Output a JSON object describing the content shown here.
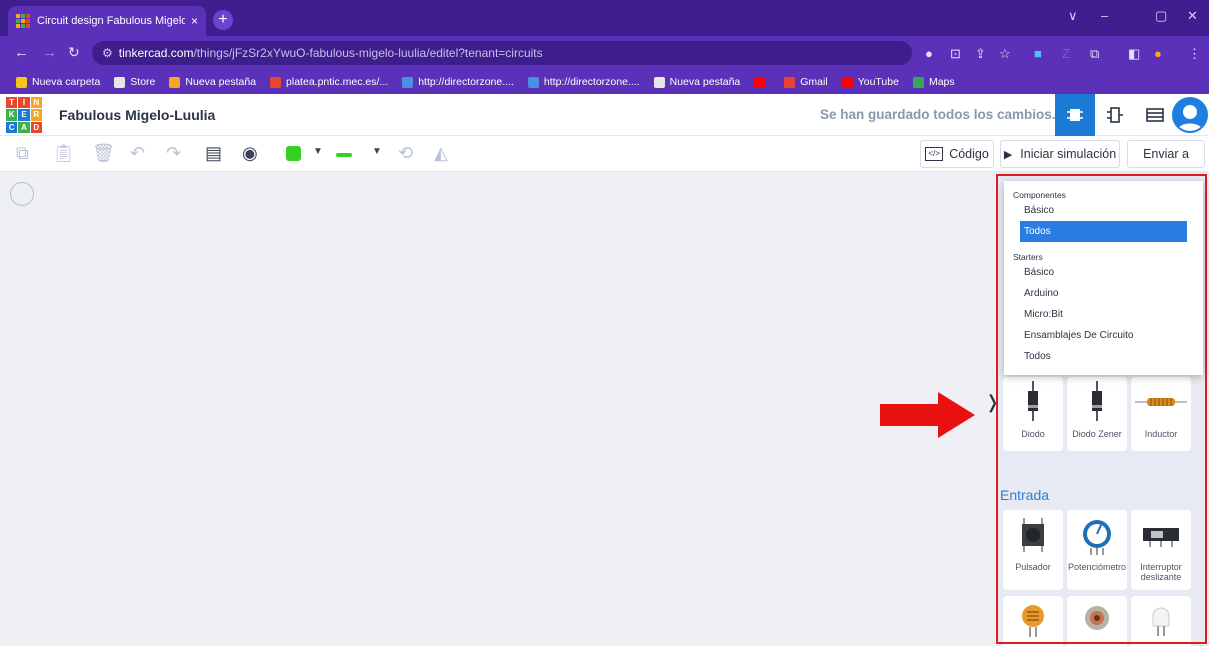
{
  "browser": {
    "tab_title": "Circuit design Fabulous Migelo",
    "tab_close": "×",
    "new_tab": "+",
    "url_host": "tinkercad.com",
    "url_path": "/things/jFzSr2xYwuO-fabulous-migelo-luulia/editel?tenant=circuits",
    "window_controls": [
      "∨",
      "–",
      "▢",
      "✕"
    ]
  },
  "bookmarks": [
    {
      "label": "Nueva carpeta",
      "icon": "folder-icon",
      "color": "#f5c518"
    },
    {
      "label": "Store",
      "icon": "globe-icon",
      "color": "#e6e6e6"
    },
    {
      "label": "Nueva pestaña",
      "icon": "page-icon",
      "color": "#f5a623"
    },
    {
      "label": "platea.pntic.mec.es/...",
      "icon": "link-icon",
      "color": "#e8472c"
    },
    {
      "label": "http://directorzone....",
      "icon": "dz-icon",
      "color": "#4a90e2"
    },
    {
      "label": "http://directorzone....",
      "icon": "dz-icon",
      "color": "#4a90e2"
    },
    {
      "label": "Nueva pestaña",
      "icon": "globe-icon",
      "color": "#e6e6e6"
    },
    {
      "label": "",
      "icon": "youtube-icon",
      "color": "#ff0000"
    },
    {
      "label": "Gmail",
      "icon": "gmail-icon",
      "color": "#ea4335"
    },
    {
      "label": "YouTube",
      "icon": "youtube-icon",
      "color": "#ff0000"
    },
    {
      "label": "Maps",
      "icon": "maps-icon",
      "color": "#34a853"
    }
  ],
  "app": {
    "logo_letters": [
      "T",
      "I",
      "N",
      "K",
      "E",
      "R",
      "C",
      "A",
      "D"
    ],
    "project_name": "Fabulous Migelo-Luulia",
    "saved_status": "Se han guardado todos los cambios."
  },
  "toolbar": {
    "code_label": "Código",
    "sim_label": "Iniciar simulación",
    "send_label": "Enviar a"
  },
  "dropdown": {
    "section1": "Componentes",
    "items1": [
      "Básico",
      "Todos"
    ],
    "selected": "Todos",
    "section2": "Starters",
    "items2": [
      "Básico",
      "Arduino",
      "Micro:Bit",
      "Ensamblajes De Circuito",
      "Todos"
    ]
  },
  "components": {
    "row1": [
      "Diodo",
      "Diodo Zener",
      "Inductor"
    ],
    "section_entrada": "Entrada",
    "row2": [
      "Pulsador",
      "Potenciómetro",
      "Interruptor deslizante"
    ]
  },
  "colors": {
    "browser_dark": "#3f1f8f",
    "browser": "#5a31b8",
    "accent_blue": "#1b7ad6",
    "wire_green": "#36d023",
    "highlight_red": "#e01b1b"
  }
}
